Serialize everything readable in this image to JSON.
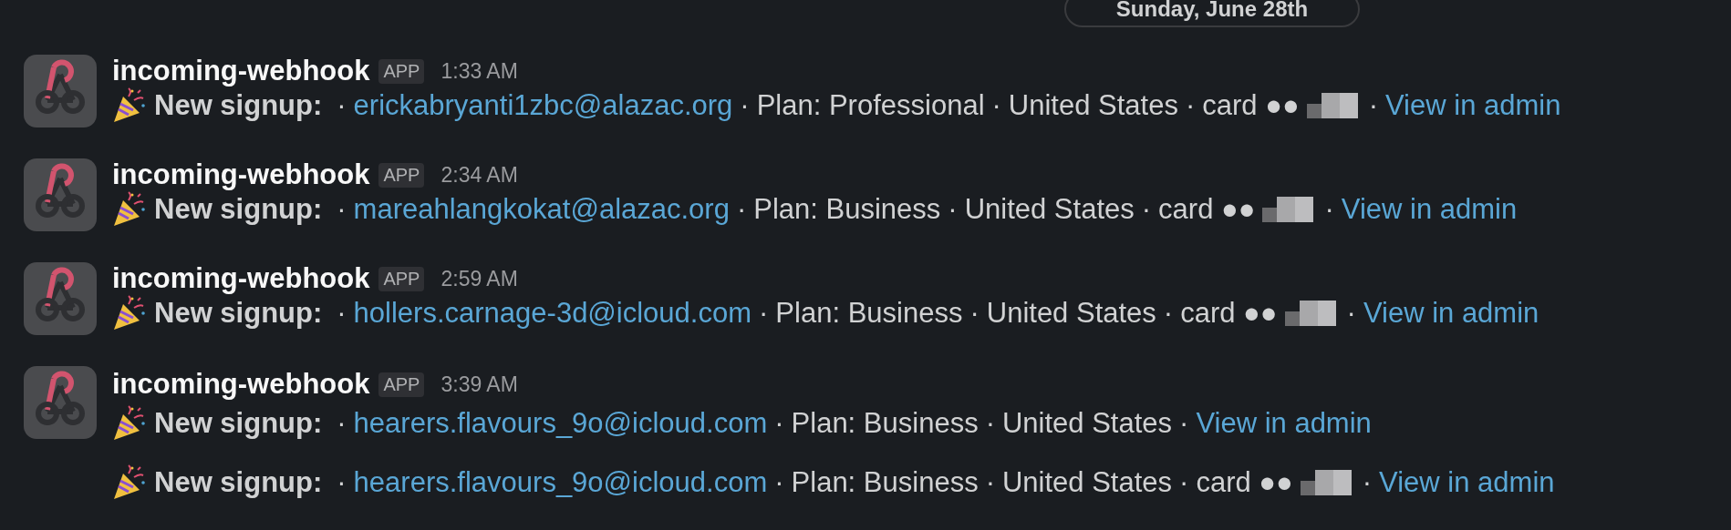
{
  "date_divider": {
    "label": "Sunday, June 28th"
  },
  "separator": "·",
  "messages": [
    {
      "sender": "incoming-webhook",
      "badge": "APP",
      "time": "1:33 AM",
      "lines": [
        {
          "title": "New signup:",
          "email": "erickabryanti1zbc@alazac.org",
          "details": [
            "Plan: Professional",
            "United States",
            "card ●●"
          ],
          "redacted": true,
          "link": "View in admin"
        }
      ]
    },
    {
      "sender": "incoming-webhook",
      "badge": "APP",
      "time": "2:34 AM",
      "lines": [
        {
          "title": "New signup:",
          "email": "mareahlangkokat@alazac.org",
          "details": [
            "Plan: Business",
            "United States",
            "card ●●"
          ],
          "redacted": true,
          "link": "View in admin"
        }
      ]
    },
    {
      "sender": "incoming-webhook",
      "badge": "APP",
      "time": "2:59 AM",
      "lines": [
        {
          "title": "New signup:",
          "email": "hollers.carnage-3d@icloud.com",
          "details": [
            "Plan: Business",
            "United States",
            "card ●●"
          ],
          "redacted": true,
          "link": "View in admin"
        }
      ]
    },
    {
      "sender": "incoming-webhook",
      "badge": "APP",
      "time": "3:39 AM",
      "lines": [
        {
          "title": "New signup:",
          "email": "hearers.flavours_9o@icloud.com",
          "details": [
            "Plan: Business",
            "United States"
          ],
          "redacted": false,
          "link": "View in admin"
        },
        {
          "title": "New signup:",
          "email": "hearers.flavours_9o@icloud.com",
          "details": [
            "Plan: Business",
            "United States",
            "card ●●"
          ],
          "redacted": true,
          "link": "View in admin"
        }
      ]
    }
  ]
}
